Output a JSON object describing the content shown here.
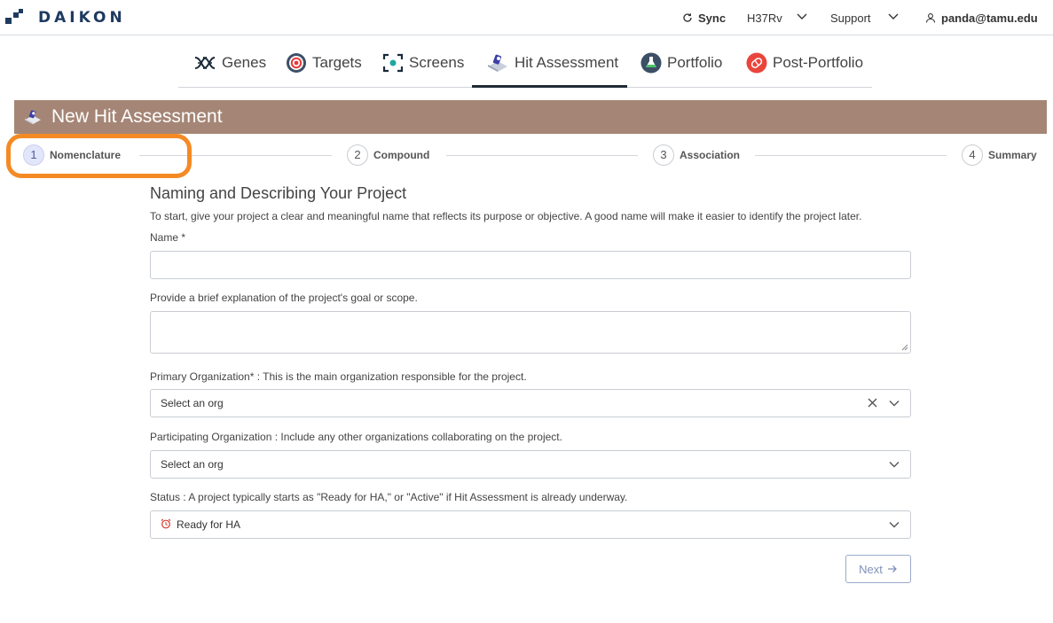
{
  "app": {
    "brand": "DAIKON",
    "sync_label": "Sync",
    "strain": "H37Rv",
    "support_label": "Support",
    "user_email": "panda@tamu.edu"
  },
  "modules": [
    {
      "label": "Genes",
      "icon": "dna-icon"
    },
    {
      "label": "Targets",
      "icon": "target-icon"
    },
    {
      "label": "Screens",
      "icon": "screen-scan-icon"
    },
    {
      "label": "Hit Assessment",
      "icon": "hit-assessment-icon",
      "active": true
    },
    {
      "label": "Portfolio",
      "icon": "flask-icon"
    },
    {
      "label": "Post-Portfolio",
      "icon": "pill-icon"
    }
  ],
  "page": {
    "title": "New Hit Assessment",
    "header_color": "#a58676"
  },
  "stepper": [
    {
      "number": "1",
      "label": "Nomenclature",
      "active": true
    },
    {
      "number": "2",
      "label": "Compound"
    },
    {
      "number": "3",
      "label": "Association"
    },
    {
      "number": "4",
      "label": "Summary"
    }
  ],
  "form": {
    "heading": "Naming and Describing Your Project",
    "intro": "To start, give your project a clear and meaningful name that reflects its purpose or objective. A good name will make it easier to identify the project later.",
    "name_label": "Name *",
    "name_value": "",
    "description_label": "Provide a brief explanation of the project's goal or scope.",
    "description_value": "",
    "primary_org_label": "Primary Organization* : This is the main organization responsible for the project.",
    "primary_org_placeholder": "Select an org",
    "participating_org_label": "Participating Organization : Include any other organizations collaborating on the project.",
    "participating_org_placeholder": "Select an org",
    "status_label": "Status : A project typically starts as \"Ready for HA,\" or \"Active\" if Hit Assessment is already underway.",
    "status_value": "Ready for HA",
    "next_label": "Next"
  },
  "colors": {
    "accent_highlight": "#f58a24",
    "brand": "#1e3a5f",
    "active_step_bg": "#e2e6fb"
  }
}
